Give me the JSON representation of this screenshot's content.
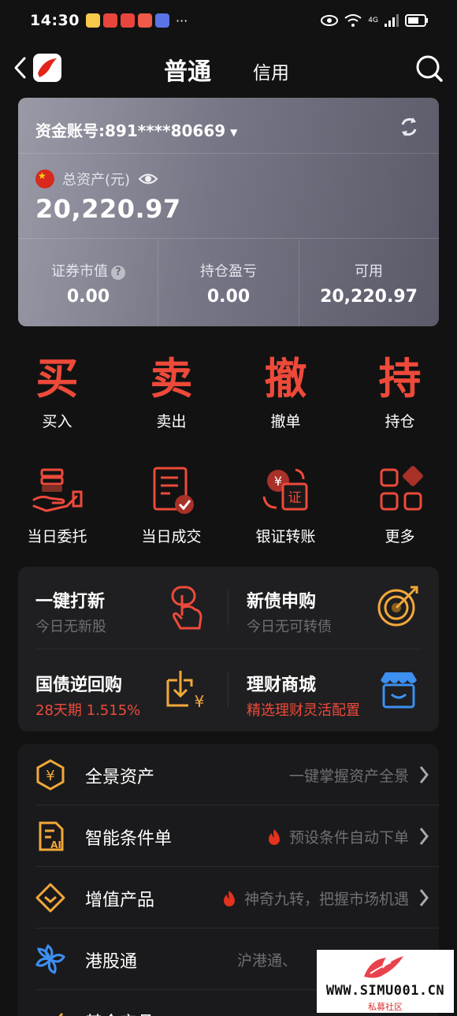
{
  "status": {
    "time": "14:30",
    "dots": "···",
    "net": "4G"
  },
  "header": {
    "tab_main": "普通",
    "tab_credit": "信用"
  },
  "account": {
    "label": "资金账号:891****80669",
    "assets_label": "总资产(元)",
    "assets_value": "20,220.97",
    "stats": [
      {
        "label": "证券市值",
        "value": "0.00"
      },
      {
        "label": "持仓盈亏",
        "value": "0.00"
      },
      {
        "label": "可用",
        "value": "20,220.97"
      }
    ],
    "help_glyph": "?"
  },
  "trade": [
    {
      "big": "买",
      "label": "买入"
    },
    {
      "big": "卖",
      "label": "卖出"
    },
    {
      "big": "撤",
      "label": "撤单"
    },
    {
      "big": "持",
      "label": "持仓"
    }
  ],
  "functions": [
    {
      "label": "当日委托",
      "icon": "hand-coins-icon"
    },
    {
      "label": "当日成交",
      "icon": "document-check-icon"
    },
    {
      "label": "银证转账",
      "icon": "bank-transfer-icon"
    },
    {
      "label": "更多",
      "icon": "grid-more-icon"
    }
  ],
  "promo": [
    {
      "title": "一键打新",
      "sub": "今日无新股"
    },
    {
      "title": "新债申购",
      "sub": "今日无可转债"
    },
    {
      "title": "国债逆回购",
      "sub": "28天期 1.515%"
    },
    {
      "title": "理财商城",
      "sub": "精选理财灵活配置"
    }
  ],
  "list": [
    {
      "name": "全景资产",
      "desc": "一键掌握资产全景"
    },
    {
      "name": "智能条件单",
      "desc": "预设条件自动下单"
    },
    {
      "name": "增值产品",
      "desc": "神奇九转，把握市场机遇"
    },
    {
      "name": "港股通",
      "desc": "沪港通、"
    },
    {
      "name": "基金产品",
      "desc": ""
    }
  ],
  "watermark": {
    "site": "WWW.SIMU001.CN",
    "cn": "私募社区"
  },
  "colors": {
    "accent_red": "#ee4a3a",
    "gold": "#f2a83a",
    "blue": "#3d8ff0",
    "background": "#121212"
  }
}
